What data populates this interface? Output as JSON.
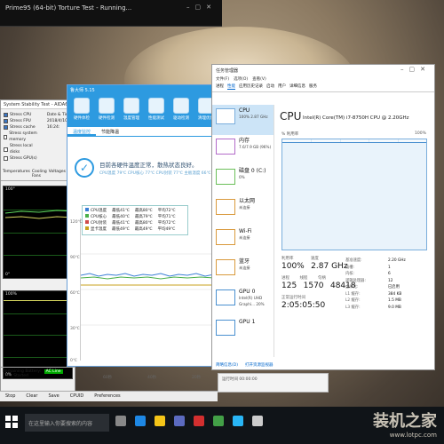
{
  "prime_window": {
    "title": "Prime95 (64-bit) Torture Test - Running..."
  },
  "aida": {
    "title": "System Stability Test - AIDA64",
    "checks": [
      {
        "label": "Stress CPU",
        "on": true
      },
      {
        "label": "Stress FPU",
        "on": true
      },
      {
        "label": "Stress cache",
        "on": true
      },
      {
        "label": "Stress system memory",
        "on": false
      },
      {
        "label": "Stress local disks",
        "on": false
      },
      {
        "label": "Stress GPU(s)",
        "on": false
      }
    ],
    "date_label": "Date & Time",
    "date_value": "2018/4/10 16:24:",
    "tabs": [
      "Temperatures",
      "Cooling Fans",
      "Voltages",
      "Pow"
    ],
    "graph1_top": "100°",
    "graph1_bottom": "0°",
    "graph2_top": "100%",
    "graph2_bottom": "0%",
    "remaining_label": "Remaining Battery:",
    "ac_label": "AC Line",
    "test_label": "Test Started",
    "buttons": [
      "Start",
      "Stop",
      "Clear",
      "Save"
    ],
    "bottom_tabs": [
      "Stop",
      "Clear",
      "Save",
      "CPUID",
      "Preferences"
    ]
  },
  "master_lu": {
    "title": "鲁大师 5.15",
    "tools": [
      "硬件体检",
      "硬件检测",
      "温度管理",
      "性能测试",
      "驱动检测",
      "清理优化",
      "装机必备"
    ],
    "tabs": [
      "温度监控",
      "节能降温"
    ],
    "status_text": "目前各硬件温度正常，散热状态良好。",
    "status_sub": "CPU温度 79℃   CPU核心 77℃   CPU封装 77℃   主板温度 66℃",
    "legend": [
      {
        "label": "CPU温度",
        "cur": "最低41℃",
        "max": "最高80℃",
        "avg": "平均72℃",
        "color": "#3a7fd5"
      },
      {
        "label": "CPU核心",
        "cur": "最低40℃",
        "max": "最高79℃",
        "avg": "平均71℃",
        "color": "#4ab04a"
      },
      {
        "label": "CPU封装",
        "cur": "最低41℃",
        "max": "最高80℃",
        "avg": "平均72℃",
        "color": "#d04a4a"
      },
      {
        "label": "显卡温度",
        "cur": "最低49℃",
        "max": "最高49℃",
        "avg": "平均49℃",
        "color": "#c9a21e"
      }
    ],
    "y_ticks": [
      "120℃",
      "90℃",
      "60℃",
      "30℃",
      "0℃"
    ],
    "x_ticks": [
      "60秒",
      "40秒",
      "20秒"
    ]
  },
  "taskmgr": {
    "title": "任务管理器",
    "menu": [
      "文件(F)",
      "选项(O)",
      "查看(V)"
    ],
    "tabs": [
      "进程",
      "性能",
      "应用历史记录",
      "启动",
      "用户",
      "详细信息",
      "服务"
    ],
    "side_items": [
      {
        "name": "CPU",
        "val": "100%  2.87 GHz"
      },
      {
        "name": "内存",
        "val": "7.6/7.9 GB (96%)"
      },
      {
        "name": "磁盘 0 (C:)",
        "val": "0%"
      },
      {
        "name": "以太网",
        "val": "未连接"
      },
      {
        "name": "Wi-Fi",
        "val": "未连接"
      },
      {
        "name": "蓝牙",
        "val": "未连接"
      },
      {
        "name": "GPU 0",
        "val": "Intel(R) UHD Graphi... 20%"
      },
      {
        "name": "GPU 1",
        "val": ""
      }
    ],
    "cpu_heading": "CPU",
    "cpu_model": "Intel(R) Core(TM) i7-8750H CPU @ 2.20GHz",
    "util_label": "% 利用率",
    "util_max": "100%",
    "stats": {
      "util_label": "利用率",
      "util_value": "100%",
      "speed_label": "速度",
      "speed_value": "2.87 GHz",
      "proc_label": "进程",
      "proc_value": "125",
      "threads_label": "线程",
      "threads_value": "1570",
      "handles_label": "句柄",
      "handles_value": "48418",
      "uptime_label": "正常运行时间",
      "uptime_value": "2:05:05:50"
    },
    "right_stats": [
      {
        "label": "基准速度:",
        "value": "2.20 GHz"
      },
      {
        "label": "插槽:",
        "value": "1"
      },
      {
        "label": "内核:",
        "value": "6"
      },
      {
        "label": "逻辑处理器:",
        "value": "12"
      },
      {
        "label": "虚拟化:",
        "value": "已启用"
      },
      {
        "label": "L1 缓存:",
        "value": "384 KB"
      },
      {
        "label": "L2 缓存:",
        "value": "1.5 MB"
      },
      {
        "label": "L3 缓存:",
        "value": "9.0 MB"
      }
    ],
    "footer_less": "简略信息(D)",
    "footer_monitor": "打开资源监视器"
  },
  "third_window": {
    "row": "运行时间 00:00:00"
  },
  "taskbar": {
    "search_placeholder": "在这里输入你要搜索的内容"
  },
  "watermark": {
    "big": "装机之家",
    "small": "www.lotpc.com"
  }
}
